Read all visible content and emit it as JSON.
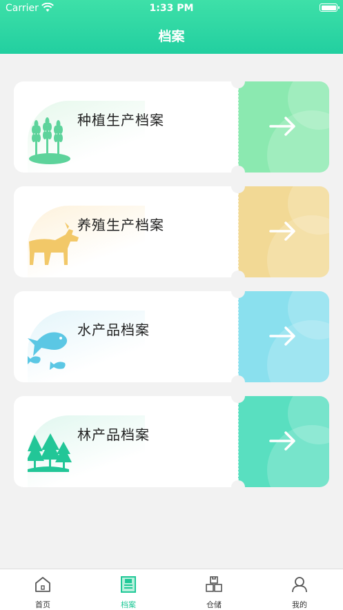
{
  "status": {
    "carrier": "Carrier",
    "time": "1:33 PM"
  },
  "header": {
    "title": "档案"
  },
  "cards": [
    {
      "label": "种植生产档案",
      "color": "#8be9b0",
      "illustration": "wheat-icon"
    },
    {
      "label": "养殖生产档案",
      "color": "#f2d995",
      "illustration": "goat-icon"
    },
    {
      "label": "水产品档案",
      "color": "#8ae0ee",
      "illustration": "fish-icon"
    },
    {
      "label": "林产品档案",
      "color": "#59dfc0",
      "illustration": "trees-icon"
    }
  ],
  "tabs": [
    {
      "label": "首页",
      "icon": "home-icon",
      "active": false
    },
    {
      "label": "档案",
      "icon": "archive-icon",
      "active": true
    },
    {
      "label": "仓储",
      "icon": "warehouse-icon",
      "active": false
    },
    {
      "label": "我的",
      "icon": "user-icon",
      "active": false
    }
  ],
  "colors": {
    "accent": "#1fc897",
    "header_top": "#3ee0a8",
    "header_bottom": "#22cfa0"
  }
}
